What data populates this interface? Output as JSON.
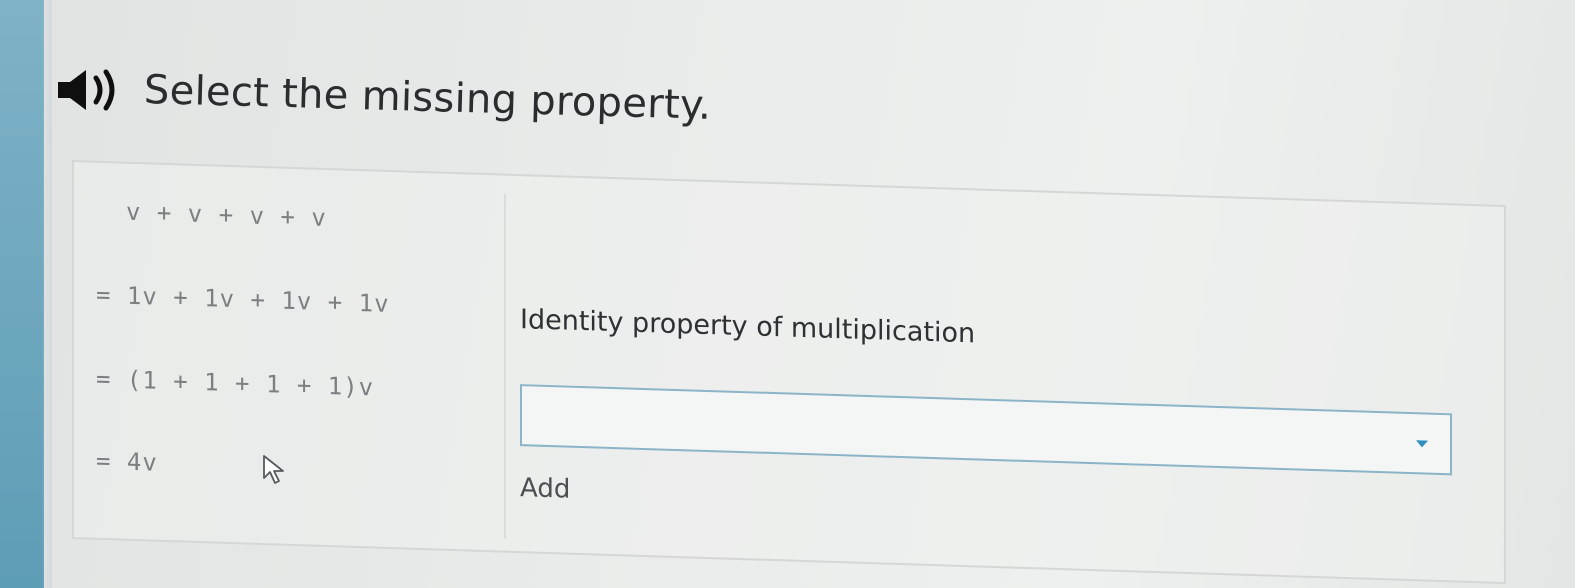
{
  "header": {
    "prompt": "Select the missing property.",
    "speaker_icon": "speaker-icon"
  },
  "problem": {
    "steps": [
      {
        "expression": "v + v + v + v",
        "reason": ""
      },
      {
        "expression": "= 1v + 1v + 1v + 1v",
        "reason": "Identity property of multiplication"
      },
      {
        "expression": "= (1 + 1 + 1 + 1)v",
        "reason": ""
      },
      {
        "expression": "= 4v",
        "reason": ""
      }
    ],
    "dropdown": {
      "selected": "",
      "caret_icon": "caret-down-icon",
      "border_color": "#8bb4c7",
      "caret_color": "#2e8fc0"
    },
    "add_label": "Add"
  },
  "cursor_icon": "mouse-pointer-icon",
  "colors": {
    "left_strip": "#6aa6be",
    "text_dark": "#2a2c2d",
    "text_muted": "#7b7f80"
  }
}
